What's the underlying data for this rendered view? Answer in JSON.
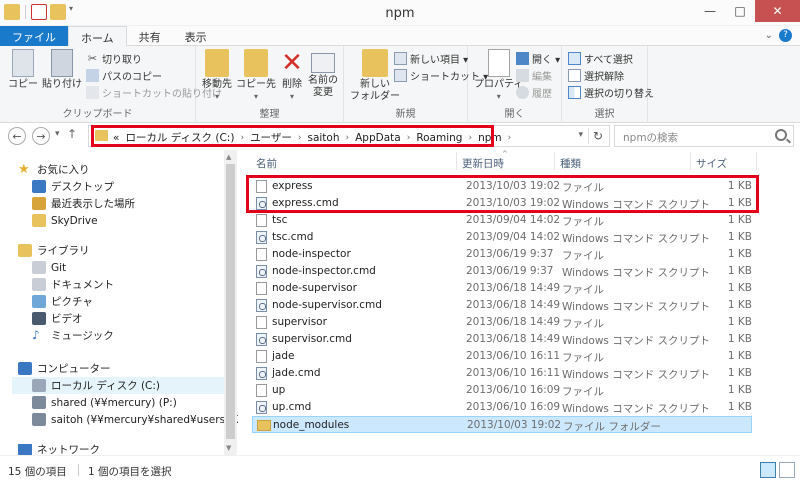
{
  "window": {
    "title": "npm",
    "minimize": "—",
    "maximize": "□",
    "close": "✕"
  },
  "ribbon_tabs": [
    "ファイル",
    "ホーム",
    "共有",
    "表示"
  ],
  "ribbon": {
    "clipboard": {
      "label": "クリップボード",
      "copy": "コピー",
      "paste": "貼り付け",
      "cut": "切り取り",
      "copy_path": "パスのコピー",
      "paste_shortcut": "ショートカットの貼り付け"
    },
    "organize": {
      "label": "整理",
      "move_to": "移動先",
      "copy_to": "コピー先",
      "delete": "削除",
      "rename_1": "名前の",
      "rename_2": "変更"
    },
    "new": {
      "label": "新規",
      "new_folder_1": "新しい",
      "new_folder_2": "フォルダー",
      "new_item": "新しい項目 ▾",
      "shortcut": "ショートカット ▾"
    },
    "open": {
      "label": "開く",
      "properties": "プロパティ",
      "open": "開く ▾",
      "edit": "編集",
      "history": "履歴"
    },
    "select": {
      "label": "選択",
      "select_all": "すべて選択",
      "select_none": "選択解除",
      "invert": "選択の切り替え"
    }
  },
  "nav": {
    "back": "←",
    "forward": "→",
    "recent": "▾",
    "up": "↑"
  },
  "address": {
    "prefix": "«",
    "crumbs": [
      "ローカル ディスク (C:)",
      "ユーザー",
      "saitoh",
      "AppData",
      "Roaming",
      "npm"
    ],
    "separator": "›",
    "dropdown": "▾",
    "refresh": "↻"
  },
  "search": {
    "placeholder": "npmの検索"
  },
  "navpane": {
    "favorites": "お気に入り",
    "desktop": "デスクトップ",
    "recent_places": "最近表示した場所",
    "skydrive": "SkyDrive",
    "libraries": "ライブラリ",
    "git": "Git",
    "documents": "ドキュメント",
    "pictures": "ピクチャ",
    "videos": "ビデオ",
    "music": "ミュージック",
    "computer": "コンピューター",
    "local_disk": "ローカル ディスク (C:)",
    "shared": "shared (¥¥mercury) (P:)",
    "saitoh_share": "saitoh (¥¥mercury¥shared¥users) (Z:)",
    "network": "ネットワーク"
  },
  "columns": {
    "name": "名前",
    "date": "更新日時",
    "type": "種類",
    "size": "サイズ"
  },
  "files": [
    {
      "name": "express",
      "date": "2013/10/03 19:02",
      "type": "ファイル",
      "size": "1 KB",
      "icon": "file"
    },
    {
      "name": "express.cmd",
      "date": "2013/10/03 19:02",
      "type": "Windows コマンド スクリプト",
      "size": "1 KB",
      "icon": "cmd"
    },
    {
      "name": "tsc",
      "date": "2013/09/04 14:02",
      "type": "ファイル",
      "size": "1 KB",
      "icon": "file"
    },
    {
      "name": "tsc.cmd",
      "date": "2013/09/04 14:02",
      "type": "Windows コマンド スクリプト",
      "size": "1 KB",
      "icon": "cmd"
    },
    {
      "name": "node-inspector",
      "date": "2013/06/19 9:37",
      "type": "ファイル",
      "size": "1 KB",
      "icon": "file"
    },
    {
      "name": "node-inspector.cmd",
      "date": "2013/06/19 9:37",
      "type": "Windows コマンド スクリプト",
      "size": "1 KB",
      "icon": "cmd"
    },
    {
      "name": "node-supervisor",
      "date": "2013/06/18 14:49",
      "type": "ファイル",
      "size": "1 KB",
      "icon": "file"
    },
    {
      "name": "node-supervisor.cmd",
      "date": "2013/06/18 14:49",
      "type": "Windows コマンド スクリプト",
      "size": "1 KB",
      "icon": "cmd"
    },
    {
      "name": "supervisor",
      "date": "2013/06/18 14:49",
      "type": "ファイル",
      "size": "1 KB",
      "icon": "file"
    },
    {
      "name": "supervisor.cmd",
      "date": "2013/06/18 14:49",
      "type": "Windows コマンド スクリプト",
      "size": "1 KB",
      "icon": "cmd"
    },
    {
      "name": "jade",
      "date": "2013/06/10 16:11",
      "type": "ファイル",
      "size": "1 KB",
      "icon": "file"
    },
    {
      "name": "jade.cmd",
      "date": "2013/06/10 16:11",
      "type": "Windows コマンド スクリプト",
      "size": "1 KB",
      "icon": "cmd"
    },
    {
      "name": "up",
      "date": "2013/06/10 16:09",
      "type": "ファイル",
      "size": "1 KB",
      "icon": "file"
    },
    {
      "name": "up.cmd",
      "date": "2013/06/10 16:09",
      "type": "Windows コマンド スクリプト",
      "size": "1 KB",
      "icon": "cmd"
    },
    {
      "name": "node_modules",
      "date": "2013/10/03 19:02",
      "type": "ファイル フォルダー",
      "size": "",
      "icon": "folder"
    }
  ],
  "status": {
    "count": "15 個の項目",
    "selected": "1 個の項目を選択"
  },
  "colors": {
    "file_tab": "#1979ca",
    "highlight_box": "#e3001b",
    "selection": "#cce8ff",
    "close_button": "#c75050"
  }
}
